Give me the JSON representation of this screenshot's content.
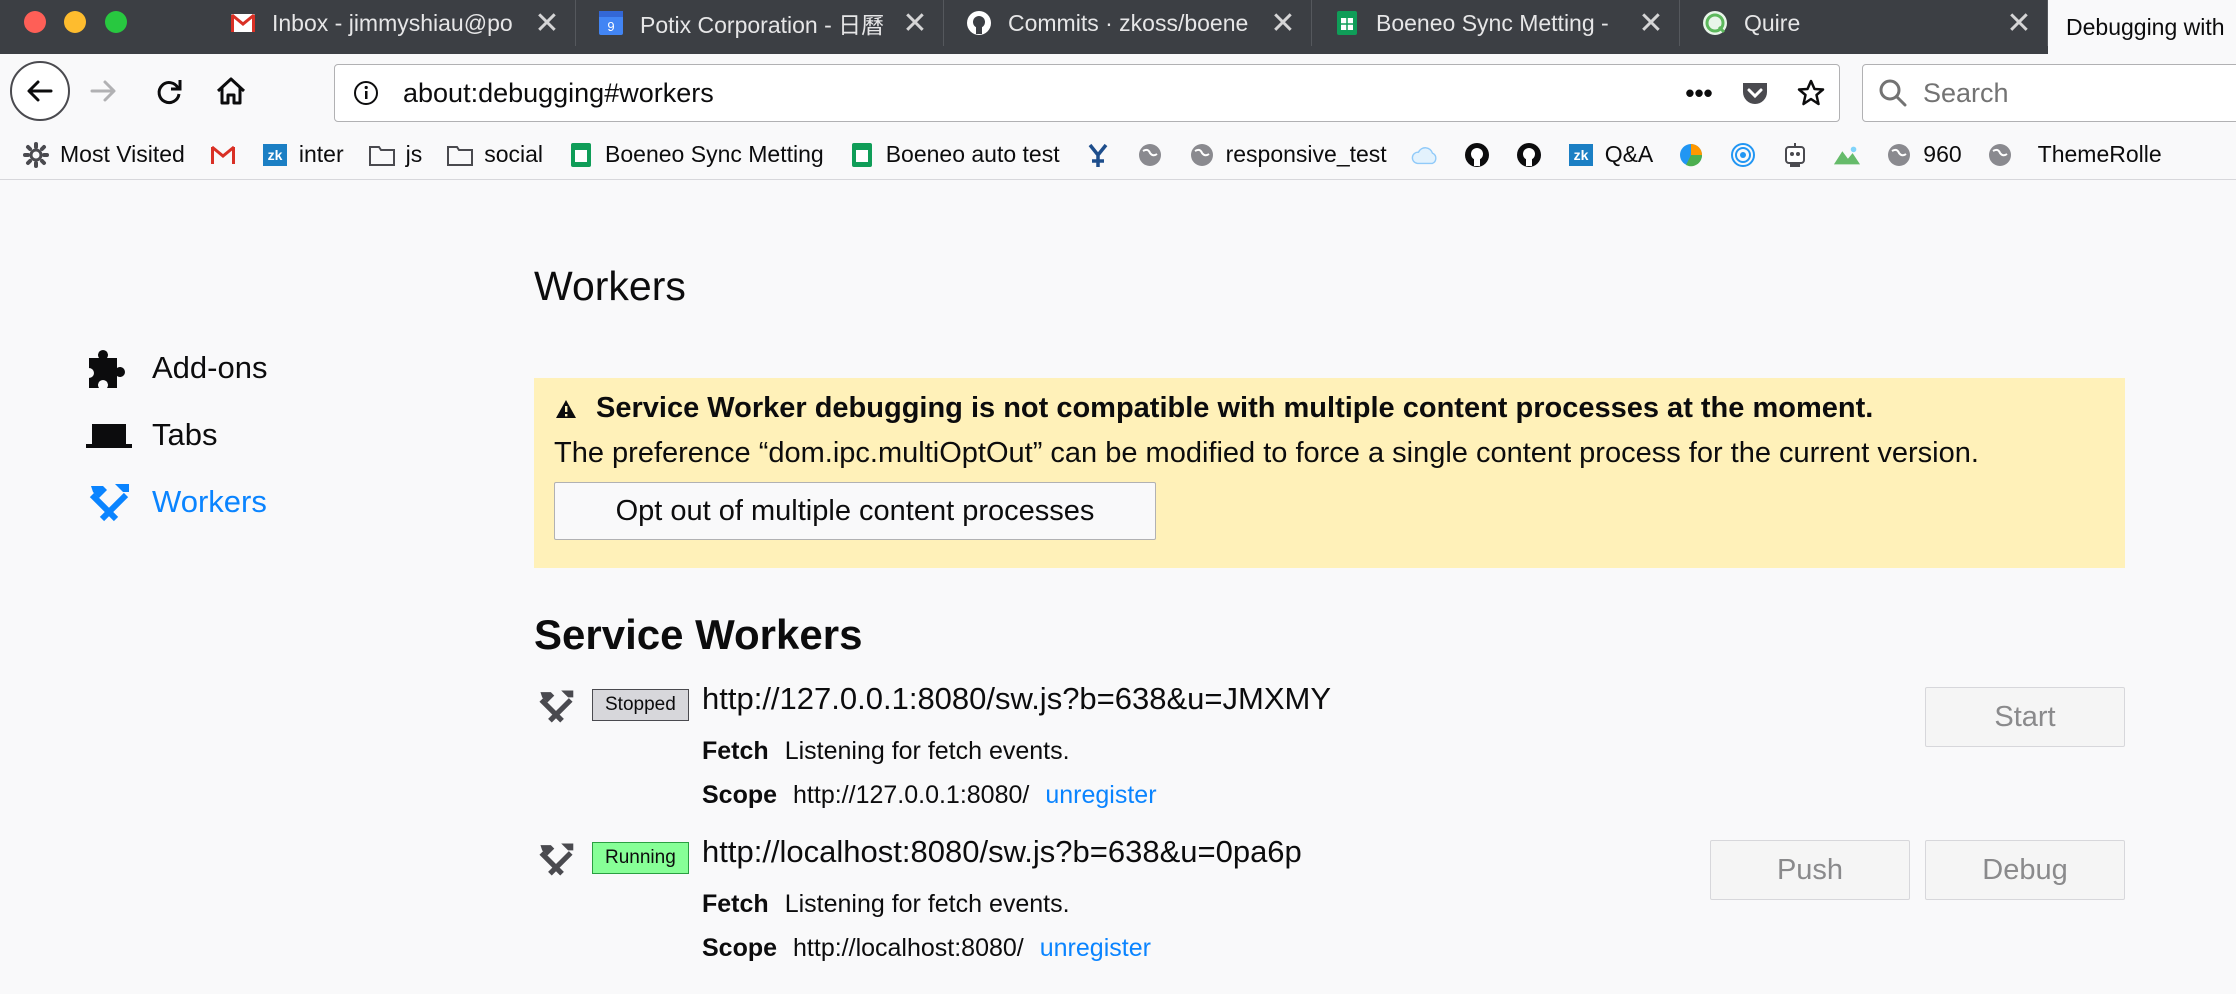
{
  "tabs": [
    {
      "title": "Inbox - jimmyshiau@po",
      "icon": "gmail-icon",
      "close": "✕"
    },
    {
      "title": "Potix Corporation - 日曆",
      "icon": "calendar-icon",
      "close": "✕"
    },
    {
      "title": "Commits · zkoss/boene",
      "icon": "github-icon",
      "close": "✕"
    },
    {
      "title": "Boeneo Sync Metting -",
      "icon": "sheets-icon",
      "close": "✕"
    },
    {
      "title": "Quire",
      "icon": "quire-icon",
      "close": "✕"
    },
    {
      "title": "Debugging with",
      "icon": "",
      "close": ""
    }
  ],
  "calendar_day": "9",
  "navbar": {
    "url": "about:debugging#workers",
    "more_actions": "•••",
    "search_placeholder": "Search"
  },
  "bookmarks": [
    {
      "label": "Most Visited",
      "icon": "gear-icon"
    },
    {
      "label": "",
      "icon": "gmail-icon"
    },
    {
      "label": "inter",
      "icon": "zk-icon"
    },
    {
      "label": "js",
      "icon": "folder-icon"
    },
    {
      "label": "social",
      "icon": "folder-icon"
    },
    {
      "label": "Boeneo Sync Metting",
      "icon": "sheets-icon"
    },
    {
      "label": "Boeneo auto test",
      "icon": "sheets-icon"
    },
    {
      "label": "",
      "icon": "jira-icon"
    },
    {
      "label": "",
      "icon": "globe-icon"
    },
    {
      "label": "responsive_test",
      "icon": "globe-icon"
    },
    {
      "label": "",
      "icon": "cloud-icon"
    },
    {
      "label": "",
      "icon": "github-icon"
    },
    {
      "label": "",
      "icon": "github-icon"
    },
    {
      "label": "Q&A",
      "icon": "zk-icon"
    },
    {
      "label": "",
      "icon": "pie-icon"
    },
    {
      "label": "",
      "icon": "target-icon"
    },
    {
      "label": "",
      "icon": "robot-icon"
    },
    {
      "label": "",
      "icon": "hills-icon"
    },
    {
      "label": "960",
      "icon": "globe-icon"
    },
    {
      "label": "",
      "icon": "globe-icon"
    },
    {
      "label": "ThemeRolle",
      "icon": ""
    }
  ],
  "sidebar": {
    "items": [
      {
        "label": "Add-ons",
        "icon": "puzzle-icon",
        "selected": false
      },
      {
        "label": "Tabs",
        "icon": "tab-icon",
        "selected": false
      },
      {
        "label": "Workers",
        "icon": "hammer-wrench-icon",
        "selected": true
      }
    ]
  },
  "main": {
    "title": "Workers",
    "warning": {
      "icon": "⚠",
      "heading": "Service Worker debugging is not compatible with multiple content processes at the moment.",
      "body": "The preference “dom.ipc.multiOptOut” can be modified to force a single content process for the current version.",
      "button": "Opt out of multiple content processes"
    },
    "section_title": "Service Workers",
    "workers": [
      {
        "status": "Stopped",
        "url": "http://127.0.0.1:8080/sw.js?b=638&u=JMXMY",
        "fetch_label": "Fetch",
        "fetch_value": "Listening for fetch events.",
        "scope_label": "Scope",
        "scope_value": "http://127.0.0.1:8080/",
        "unregister": "unregister",
        "buttons": [
          "Start"
        ]
      },
      {
        "status": "Running",
        "url": "http://localhost:8080/sw.js?b=638&u=0pa6p",
        "fetch_label": "Fetch",
        "fetch_value": "Listening for fetch events.",
        "scope_label": "Scope",
        "scope_value": "http://localhost:8080/",
        "unregister": "unregister",
        "buttons": [
          "Push",
          "Debug"
        ]
      }
    ]
  },
  "colors": {
    "accent": "#0a84ff",
    "warning_bg": "#fff1b9",
    "running_badge": "#87ff97",
    "stopped_badge": "#d7d7db"
  }
}
